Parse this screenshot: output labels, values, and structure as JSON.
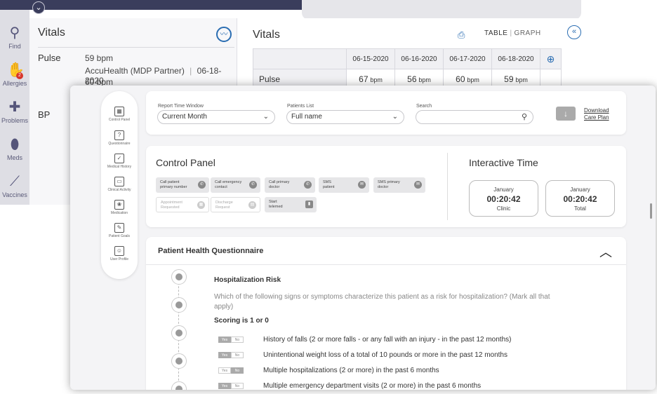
{
  "back_window": {
    "rail": [
      {
        "label": "Find",
        "icon": "search-icon"
      },
      {
        "label": "Allergies",
        "icon": "hand-icon",
        "badge": "2"
      },
      {
        "label": "Problems",
        "icon": "bandage-icon"
      },
      {
        "label": "Meds",
        "icon": "pill-icon"
      },
      {
        "label": "Vaccines",
        "icon": "syringe-icon"
      }
    ],
    "vitals_left": {
      "title": "Vitals",
      "pulse_label": "Pulse",
      "pulse_value": "59 bpm",
      "pulse_source": "AccuHealth (MDP Partner)",
      "pulse_date": "06-18-2020",
      "pulse_value2": "60 bpm",
      "bp_label": "BP"
    },
    "vitals_right": {
      "title": "Vitals",
      "view_table": "TABLE",
      "view_graph": "GRAPH",
      "dates": [
        "06-15-2020",
        "06-16-2020",
        "06-17-2020",
        "06-18-2020"
      ],
      "row_label": "Pulse",
      "values": [
        "67",
        "56",
        "60",
        "59"
      ],
      "unit": "bpm"
    }
  },
  "front_window": {
    "side_nav": [
      {
        "label": "Control Panel",
        "glyph": "▦"
      },
      {
        "label": "Questionnaire",
        "glyph": "?"
      },
      {
        "label": "Medical History",
        "glyph": "✓"
      },
      {
        "label": "Clinical Activity",
        "glyph": "▭"
      },
      {
        "label": "Medication",
        "glyph": "❀"
      },
      {
        "label": "Patient Goals",
        "glyph": "✎"
      },
      {
        "label": "User Profile",
        "glyph": "☺"
      }
    ],
    "filters": {
      "report_label": "Report Time Window",
      "report_value": "Current Month",
      "patients_label": "Patients List",
      "patients_value": "Full name",
      "search_label": "Search",
      "search_value": "",
      "download_line1": "Download",
      "download_line2": "Care Plan"
    },
    "control_panel": {
      "title": "Control Panel",
      "buttons_row1": [
        {
          "l1": "Call patient",
          "l2": "primary number"
        },
        {
          "l1": "Call emergency",
          "l2": "contact"
        },
        {
          "l1": "Call primary",
          "l2": "doctor"
        },
        {
          "l1": "SMS",
          "l2": "patient"
        },
        {
          "l1": "SMS primary",
          "l2": "doctor"
        }
      ],
      "buttons_row2": [
        {
          "l1": "Appointment",
          "l2": "Requested"
        },
        {
          "l1": "Discharge",
          "l2": "Request"
        },
        {
          "l1": "Start",
          "l2": "telemed"
        }
      ]
    },
    "interactive_time": {
      "title": "Interactive Time",
      "boxes": [
        {
          "month": "January",
          "time": "00:20:42",
          "caption": "Clinic"
        },
        {
          "month": "January",
          "time": "00:20:42",
          "caption": "Total"
        }
      ]
    },
    "questionnaire": {
      "title": "Patient Health Questionnaire",
      "section": "Hospitalization Risk",
      "prompt": "Which of the following signs or symptoms characterize this patient as a risk for hospitalization? (Mark all that apply)",
      "scoring": "Scoring is 1 or 0",
      "yes": "Yes",
      "no": "No",
      "items": [
        {
          "text": "History of falls (2 or more falls - or any fall with an injury - in the past 12 months)",
          "selected": "yes"
        },
        {
          "text": "Unintentional weight loss of a total of 10 pounds or more in the past 12 months",
          "selected": "yes"
        },
        {
          "text": "Multiple hospitalizations (2 or more) in the past 6 months",
          "selected": "no"
        },
        {
          "text": "Multiple emergency department visits (2 or more) in the past 6 months",
          "selected": "yes"
        }
      ]
    }
  }
}
